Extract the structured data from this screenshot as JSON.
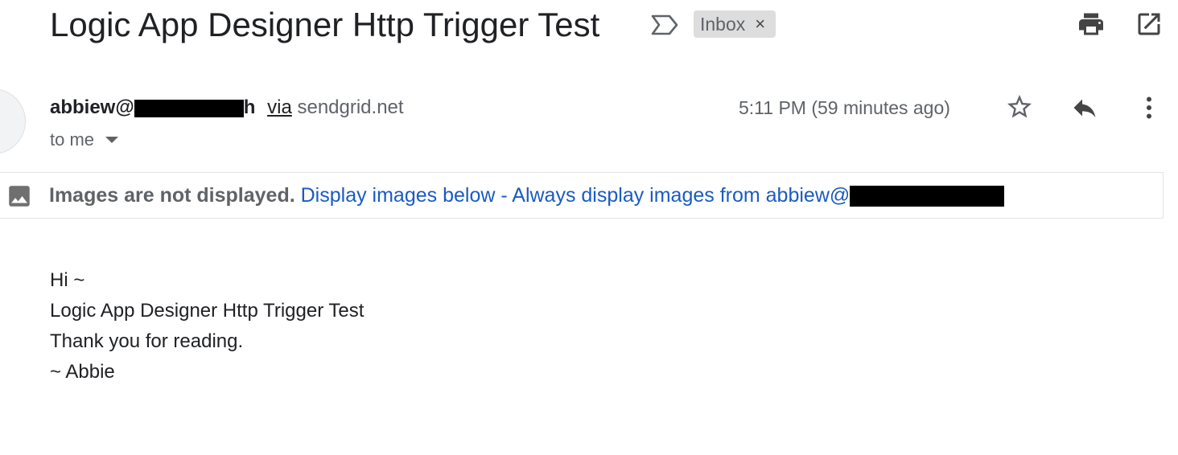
{
  "email": {
    "subject": "Logic App Designer Http Trigger Test",
    "label": "Inbox",
    "label_close": "×",
    "sender_prefix": "abbiew@",
    "sender_suffix": "h",
    "via_word": "via",
    "via_domain": "sendgrid.net",
    "recipient": "to me",
    "timestamp": "5:11 PM (59 minutes ago)",
    "images_notice": {
      "warning": "Images are not displayed.",
      "display_below": "Display images below",
      "separator": "-",
      "always_display": "Always display images from abbiew@"
    },
    "body_lines": [
      "Hi ~",
      "Logic App Designer Http Trigger Test",
      "Thank you for reading.",
      "~ Abbie"
    ]
  },
  "icons": {
    "important": "important-marker-icon",
    "print": "print-icon",
    "open_new_window": "open-in-new-window-icon",
    "star": "star-icon",
    "reply": "reply-icon",
    "more": "more-vert-icon",
    "image": "image-icon",
    "dropdown": "chevron-down-icon"
  },
  "colors": {
    "text": "#202124",
    "muted": "#5f6368",
    "link": "#1a5bc4",
    "chip_bg": "#dddddd",
    "redaction": "#000000"
  }
}
